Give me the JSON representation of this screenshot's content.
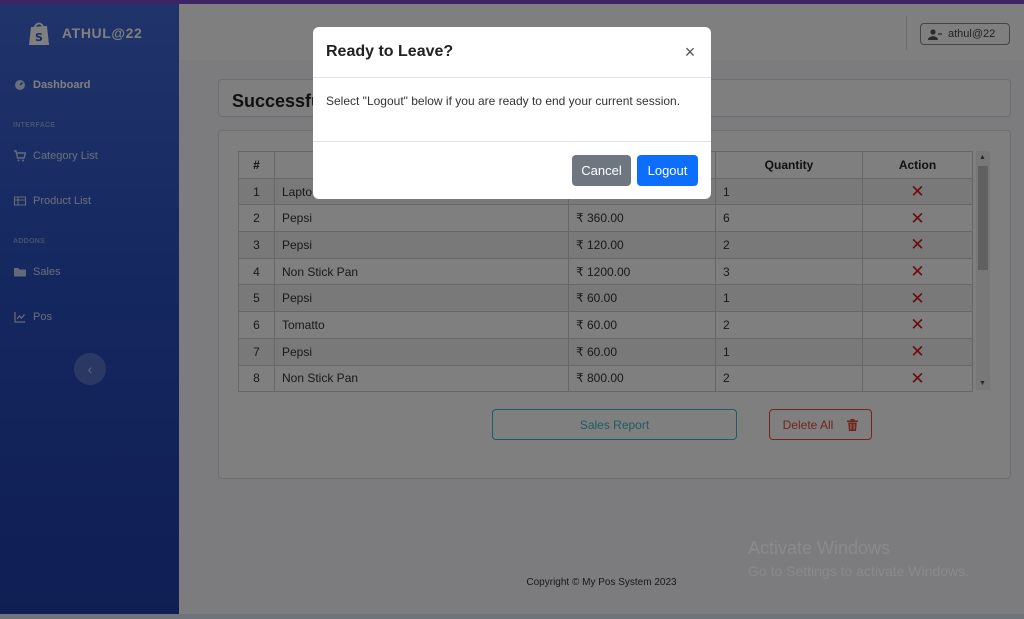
{
  "brand": {
    "name": "ATHUL@22",
    "logo_icon": "shopify-bag-icon"
  },
  "sidebar": {
    "items": [
      {
        "label": "Dashboard",
        "icon": "dashboard-icon"
      },
      {
        "label": "Category List",
        "icon": "cart-icon"
      },
      {
        "label": "Product List",
        "icon": "table-icon"
      },
      {
        "label": "Sales",
        "icon": "folder-icon"
      },
      {
        "label": "Pos",
        "icon": "chart-icon"
      }
    ],
    "headings": [
      "INTERFACE",
      "ADDONS"
    ]
  },
  "topbar": {
    "user": "athul@22"
  },
  "alert": {
    "text": "Successfu"
  },
  "table": {
    "headers": [
      "#",
      "",
      "",
      "Quantity",
      "Action"
    ],
    "rows": [
      {
        "no": "1",
        "name": "Lapto",
        "price": "",
        "qty": "1"
      },
      {
        "no": "2",
        "name": "Pepsi",
        "price": "₹ 360.00",
        "qty": "6"
      },
      {
        "no": "3",
        "name": "Pepsi",
        "price": "₹ 120.00",
        "qty": "2"
      },
      {
        "no": "4",
        "name": "Non Stick Pan",
        "price": "₹ 1200.00",
        "qty": "3"
      },
      {
        "no": "5",
        "name": "Pepsi",
        "price": "₹ 60.00",
        "qty": "1"
      },
      {
        "no": "6",
        "name": "Tomatto",
        "price": "₹ 60.00",
        "qty": "2"
      },
      {
        "no": "7",
        "name": "Pepsi",
        "price": "₹ 60.00",
        "qty": "1"
      },
      {
        "no": "8",
        "name": "Non Stick Pan",
        "price": "₹ 800.00",
        "qty": "2"
      }
    ],
    "action_symbol": "✕"
  },
  "buttons": {
    "sales_report": "Sales Report",
    "delete_all": "Delete All"
  },
  "footer": {
    "copyright": "Copyright © My Pos System 2023"
  },
  "watermark": {
    "line1": "Activate Windows",
    "line2": "Go to Settings to activate Windows."
  },
  "modal": {
    "title": "Ready to Leave?",
    "close": "×",
    "body": "Select \"Logout\" below if you are ready to end your current session.",
    "cancel": "Cancel",
    "logout": "Logout"
  },
  "colors": {
    "sidebar": "#2a4fbf",
    "accent_purple": "#7b49c8",
    "primary": "#0d6efd",
    "danger": "#e74a3b",
    "info": "#36b9cc"
  }
}
